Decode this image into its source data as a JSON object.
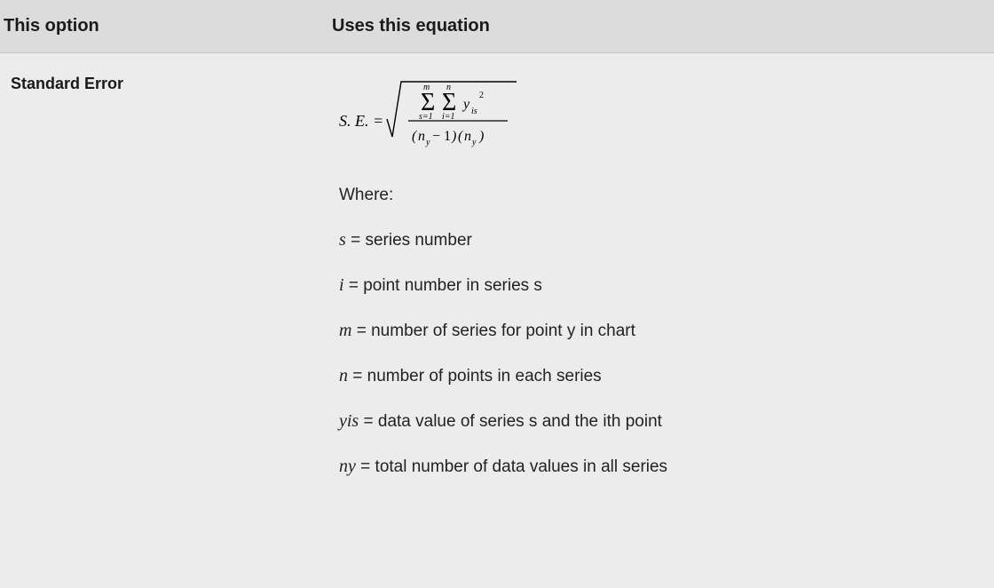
{
  "header": {
    "col1": "This option",
    "col2": "Uses this equation"
  },
  "entry": {
    "name": "Standard Error",
    "equation": {
      "label_se": "S. E. =",
      "outer_sum_top": "m",
      "outer_sum_bottom": "s=1",
      "inner_sum_top": "n",
      "inner_sum_bottom": "i=1",
      "term_base": "y",
      "term_sub": "is",
      "term_sup": "2",
      "denom": "(n_y− 1)(n_y)"
    },
    "where_label": "Where:",
    "defs": [
      {
        "sym": "s",
        "text": " = series number"
      },
      {
        "sym": "i",
        "text": " = point number in series s"
      },
      {
        "sym": "m",
        "text": " = number of series for point y in chart"
      },
      {
        "sym": "n",
        "text": " = number of points in each series"
      },
      {
        "sym": "yis",
        "text": " = data value of series s and the ith point"
      },
      {
        "sym": "ny",
        "text": " = total number of data values in all series"
      }
    ]
  }
}
